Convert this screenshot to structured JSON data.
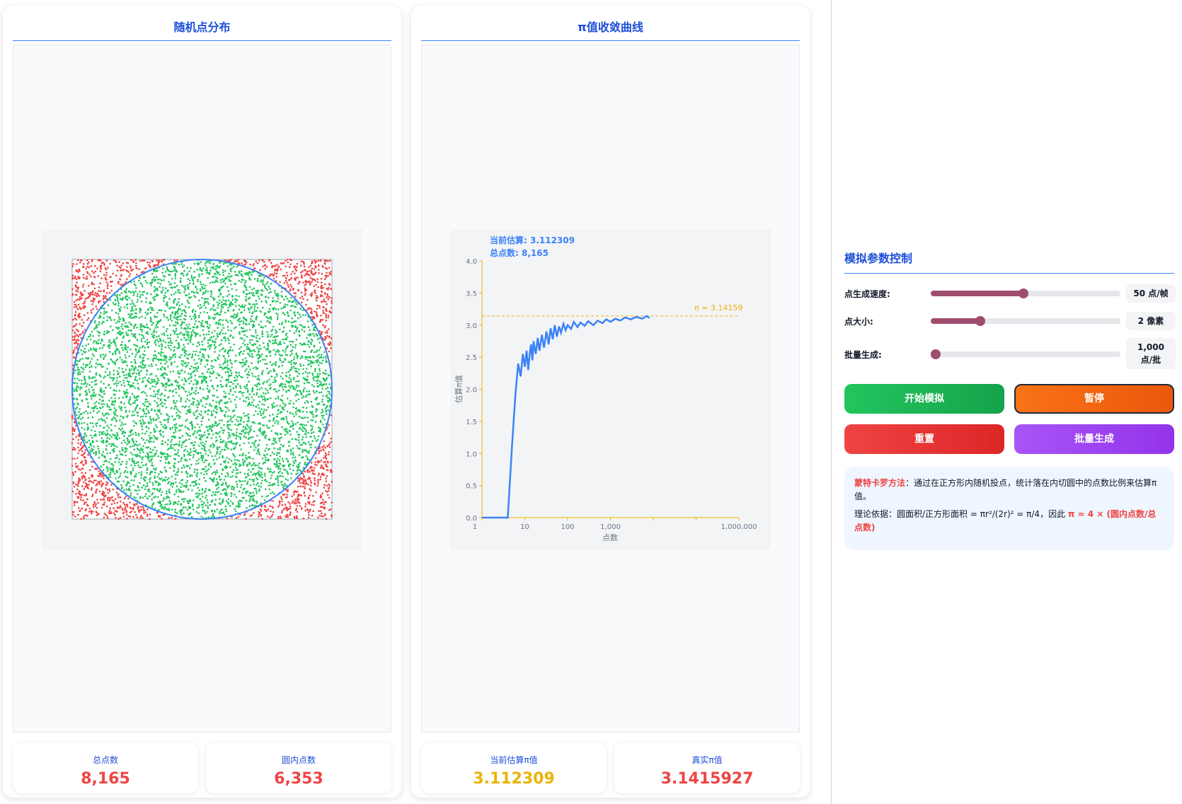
{
  "left_panel": {
    "title": "随机点分布",
    "stats": {
      "total_label": "总点数",
      "total_value": "8,165",
      "inside_label": "圆内点数",
      "inside_value": "6,353"
    }
  },
  "middle_panel": {
    "title": "π值收敛曲线",
    "stats": {
      "estimate_label": "当前估算π值",
      "estimate_value": "3.112309",
      "true_label": "真实π值",
      "true_value": "3.1415927"
    }
  },
  "chart_data": {
    "type": "line",
    "xlabel": "点数",
    "ylabel": "估算π值",
    "x_scale": "log",
    "xlim": [
      1,
      1000000
    ],
    "ylim": [
      0,
      4
    ],
    "x_ticks": [
      "1",
      "10",
      "100",
      "1,000",
      "1,000,000"
    ],
    "y_ticks": [
      "0.0",
      "0.5",
      "1.0",
      "1.5",
      "2.0",
      "2.5",
      "3.0",
      "3.5",
      "4.0"
    ],
    "annotations": {
      "estimate_text": "当前估算: 3.112309",
      "total_text": "总点数: 8,165",
      "reference_label": "π = 3.14159"
    },
    "reference_line": {
      "y": 3.14159,
      "color": "#eab308"
    },
    "series": [
      {
        "color": "#3b82f6",
        "points": [
          [
            1,
            0
          ],
          [
            2,
            0
          ],
          [
            3,
            0
          ],
          [
            4,
            0
          ],
          [
            5,
            1.1
          ],
          [
            6,
            1.9
          ],
          [
            7,
            2.4
          ],
          [
            8,
            2.2
          ],
          [
            9,
            2.55
          ],
          [
            10,
            2.35
          ],
          [
            11,
            2.6
          ],
          [
            12,
            2.3
          ],
          [
            13,
            2.55
          ],
          [
            14,
            2.7
          ],
          [
            15,
            2.45
          ],
          [
            16,
            2.75
          ],
          [
            18,
            2.55
          ],
          [
            20,
            2.8
          ],
          [
            22,
            2.6
          ],
          [
            25,
            2.85
          ],
          [
            28,
            2.65
          ],
          [
            32,
            2.9
          ],
          [
            36,
            2.7
          ],
          [
            40,
            2.95
          ],
          [
            45,
            2.78
          ],
          [
            50,
            3.0
          ],
          [
            56,
            2.82
          ],
          [
            63,
            2.98
          ],
          [
            70,
            2.88
          ],
          [
            80,
            3.02
          ],
          [
            90,
            2.92
          ],
          [
            100,
            3.0
          ],
          [
            120,
            2.94
          ],
          [
            140,
            3.05
          ],
          [
            170,
            2.97
          ],
          [
            200,
            3.04
          ],
          [
            250,
            2.99
          ],
          [
            300,
            3.06
          ],
          [
            400,
            3.0
          ],
          [
            500,
            3.07
          ],
          [
            650,
            3.03
          ],
          [
            800,
            3.09
          ],
          [
            1000,
            3.05
          ],
          [
            1300,
            3.1
          ],
          [
            1700,
            3.07
          ],
          [
            2200,
            3.12
          ],
          [
            3000,
            3.09
          ],
          [
            4000,
            3.13
          ],
          [
            5500,
            3.1
          ],
          [
            7000,
            3.14
          ],
          [
            8165,
            3.112309
          ]
        ]
      }
    ]
  },
  "controls": {
    "title": "模拟参数控制",
    "speed": {
      "label": "点生成速度:",
      "value_text": "50 点/帧",
      "level": 0.49
    },
    "size": {
      "label": "点大小:",
      "value_text": "2 像素",
      "level": 0.26
    },
    "batch": {
      "label": "批量生成:",
      "value_line1": "1,000",
      "value_line2": "点/批",
      "level": 0.02
    },
    "buttons": {
      "start": "开始模拟",
      "pause": "暂停",
      "reset": "重置",
      "batch": "批量生成"
    },
    "info": {
      "method_title": "蒙特卡罗方法",
      "method_text": "：通过在正方形内随机投点，统计落在内切圆中的点数比例来估算π值。",
      "theory_text": "理论依据：圆面积/正方形面积 = πr²/(2r)² = π/4，因此 ",
      "theory_formula": "π ≈ 4 × (圆内点数/总点数)"
    }
  },
  "colors": {
    "inside_points": "#22c55e",
    "outside_points": "#ef4444",
    "circle": "#3b82f6",
    "line": "#3b82f6",
    "reference": "#eab308"
  }
}
